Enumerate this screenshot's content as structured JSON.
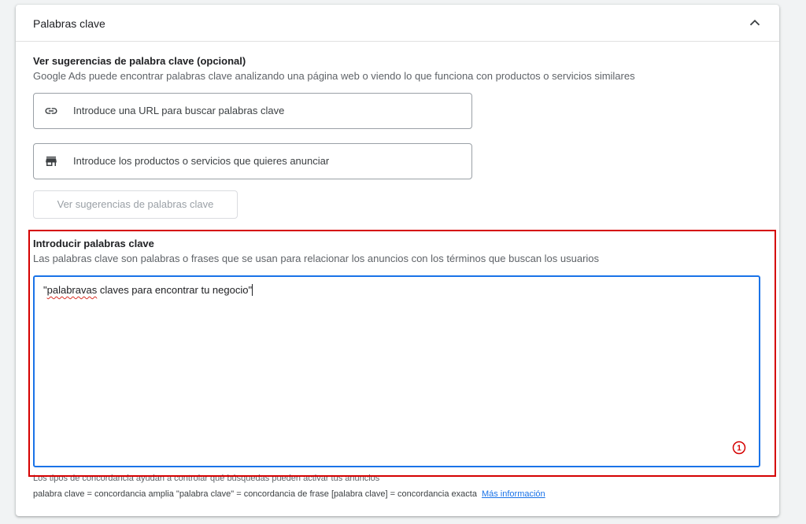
{
  "card": {
    "title": "Palabras clave"
  },
  "suggestions": {
    "title": "Ver sugerencias de palabra clave (opcional)",
    "description": "Google Ads puede encontrar palabras clave analizando una página web o viendo lo que funciona con productos o servicios similares",
    "url_placeholder": "Introduce una URL para buscar palabras clave",
    "products_placeholder": "Introduce los productos o servicios que quieres anunciar",
    "button_label": "Ver sugerencias de palabras clave"
  },
  "enter_keywords": {
    "title": "Introducir palabras clave",
    "description": "Las palabras clave son palabras o frases que se usan para relacionar los anuncios con los términos que buscan los usuarios",
    "text_quote_open": "\"",
    "text_misspelled": "palabravas",
    "text_rest": " claves para encontrar tu negocio\"",
    "badge_count": "1"
  },
  "hints": {
    "line1": "Los tipos de concordancia ayudan a controlar qué búsquedas pueden activar tus anuncios",
    "line2": "palabra clave = concordancia amplia   \"palabra clave\" = concordancia de frase   [palabra clave] = concordancia exacta",
    "link": "Más información"
  },
  "colors": {
    "accent": "#1a73e8",
    "highlight_frame": "#d50000",
    "error": "#d93025"
  }
}
